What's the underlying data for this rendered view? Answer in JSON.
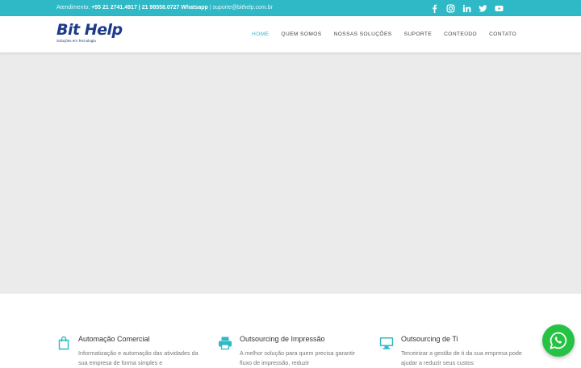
{
  "topbar": {
    "label": "Atendimento:",
    "phones": "+55 21 2741.4917 | 21 98558.0727 Whatsapp",
    "separator": "|",
    "email": "suporte@bithelp.com.br",
    "social_icons": [
      "facebook-icon",
      "instagram-icon",
      "linkedin-icon",
      "twitter-icon",
      "youtube-icon"
    ]
  },
  "logo": {
    "name": "Bit Help",
    "tagline": "Soluções em Tecnologia"
  },
  "nav": {
    "items": [
      "HOME",
      "QUEM SOMOS",
      "NOSSAS SOLUÇÕES",
      "SUPORTE",
      "CONTEÚDO",
      "CONTATO"
    ],
    "active": "HOME"
  },
  "features": [
    {
      "icon": "shopping-bag-icon",
      "title": "Automação Comercial",
      "description": "Informatização e automação das atividades da sua empresa de forma simples e"
    },
    {
      "icon": "printer-icon",
      "title": "Outsourcing de Impressão",
      "description": "A melhor solução para quem precisa garantir fluxo de impressão, reduzir"
    },
    {
      "icon": "monitor-icon",
      "title": "Outsourcing de Ti",
      "description": "Terceirizar a gestão de ti da sua empresa pode ajudar a reduzir seus custos"
    }
  ],
  "colors": {
    "accent": "#2fb8c6",
    "brand": "#1d3b8a",
    "hero_bg": "#ebebeb",
    "whatsapp": "#25c244"
  }
}
